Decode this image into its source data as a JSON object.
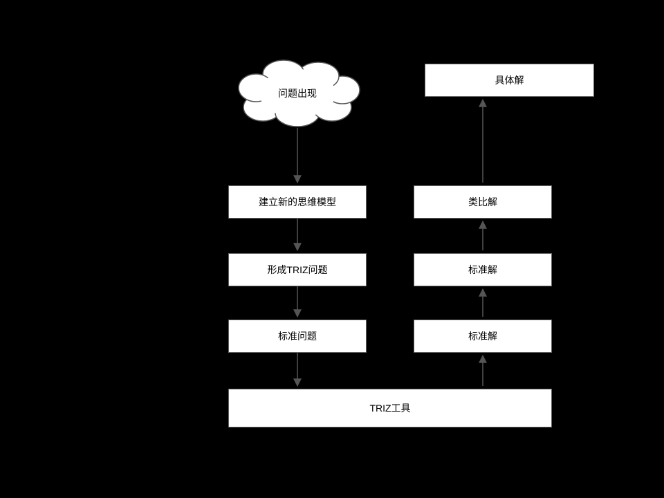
{
  "nodes": {
    "start": "问题出现",
    "left1": "建立新的思维模型",
    "left2": "形成TRIZ问题",
    "left3": "标准问题",
    "right1": "具体解",
    "right2": "类比解",
    "right3": "标准解",
    "bottom": "TRIZ工具"
  }
}
